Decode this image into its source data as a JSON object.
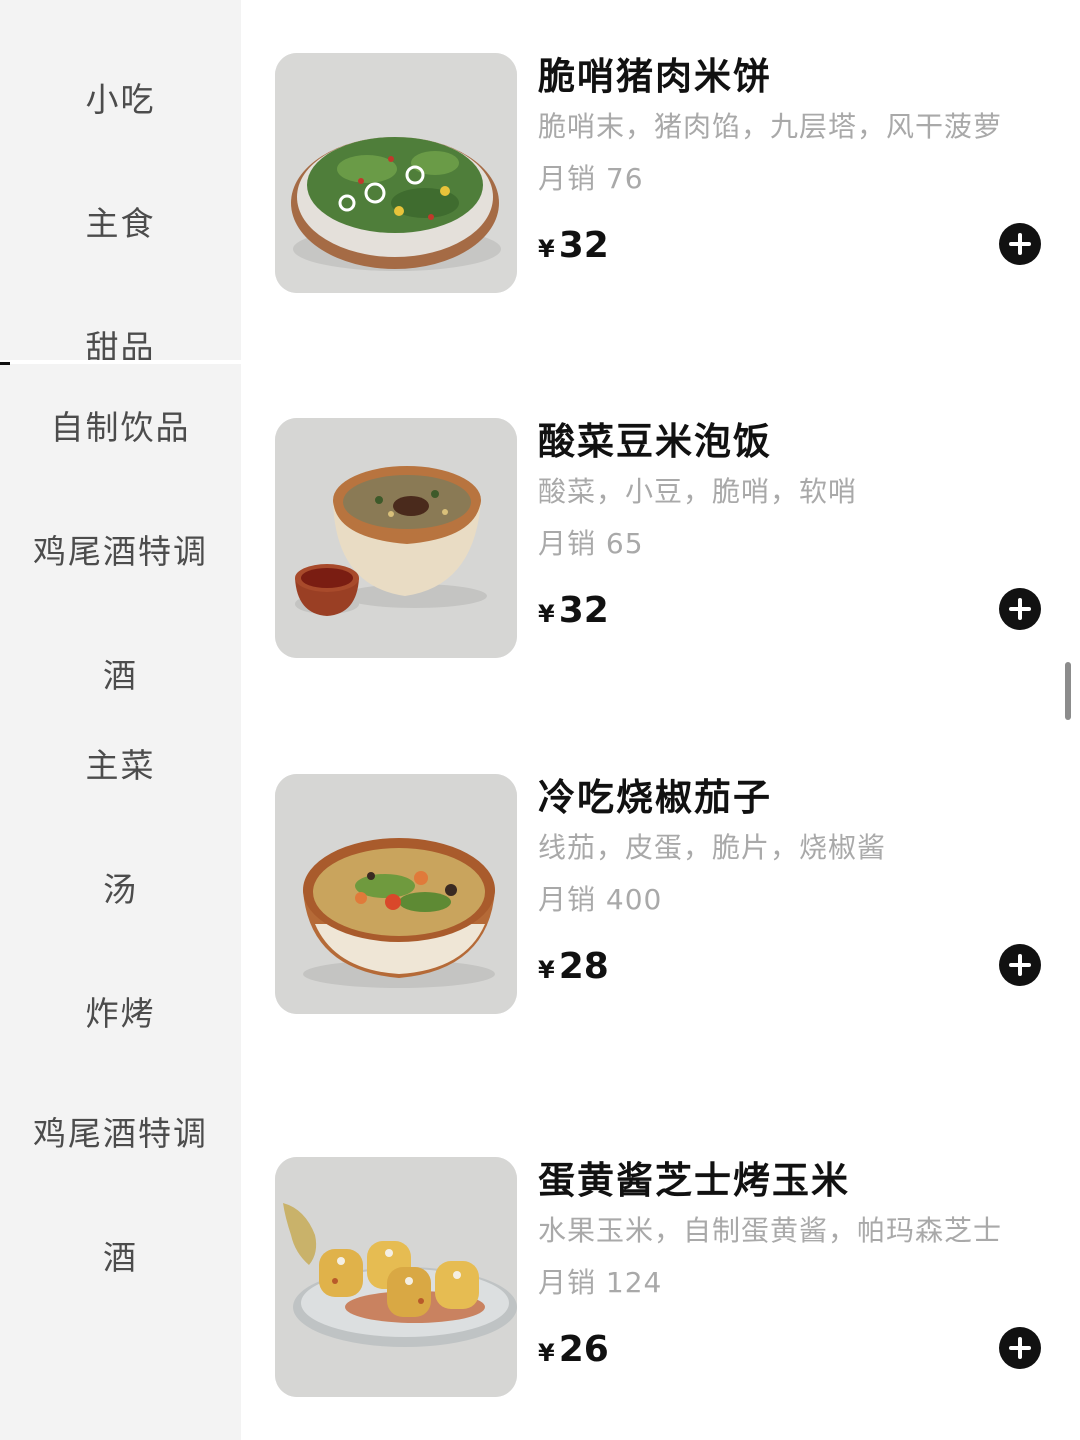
{
  "sidebar": {
    "categories": [
      {
        "label": "小吃"
      },
      {
        "label": "主食"
      },
      {
        "label": "甜品"
      },
      {
        "label": "自制饮品"
      },
      {
        "label": "鸡尾酒特调"
      },
      {
        "label": "酒"
      },
      {
        "label": "主菜"
      },
      {
        "label": "汤"
      },
      {
        "label": "炸烤"
      },
      {
        "label": "鸡尾酒特调"
      },
      {
        "label": "酒"
      }
    ]
  },
  "menu": {
    "currency_symbol": "¥",
    "items": [
      {
        "name": "脆哨猪肉米饼",
        "desc": "脆哨末，猪肉馅，九层塔，风干菠萝",
        "sales": "月销 76",
        "price": "32",
        "image": "pizza-photo"
      },
      {
        "name": "酸菜豆米泡饭",
        "desc": "酸菜，小豆，脆哨，软哨",
        "sales": "月销 65",
        "price": "32",
        "image": "soup-bowl-photo"
      },
      {
        "name": "冷吃烧椒茄子",
        "desc": "线茄，皮蛋，脆片，烧椒酱",
        "sales": "月销 400",
        "price": "28",
        "image": "eggplant-bowl-photo"
      },
      {
        "name": "蛋黄酱芝士烤玉米",
        "desc": "水果玉米，自制蛋黄酱，帕玛森芝士",
        "sales": "月销 124",
        "price": "26",
        "image": "grilled-corn-photo"
      }
    ]
  },
  "colors": {
    "sidebar_bg": "#f3f3f3",
    "text_primary": "#111111",
    "text_secondary": "#a9a9a9",
    "category_text": "#4c4c4c",
    "add_button": "#111111"
  }
}
